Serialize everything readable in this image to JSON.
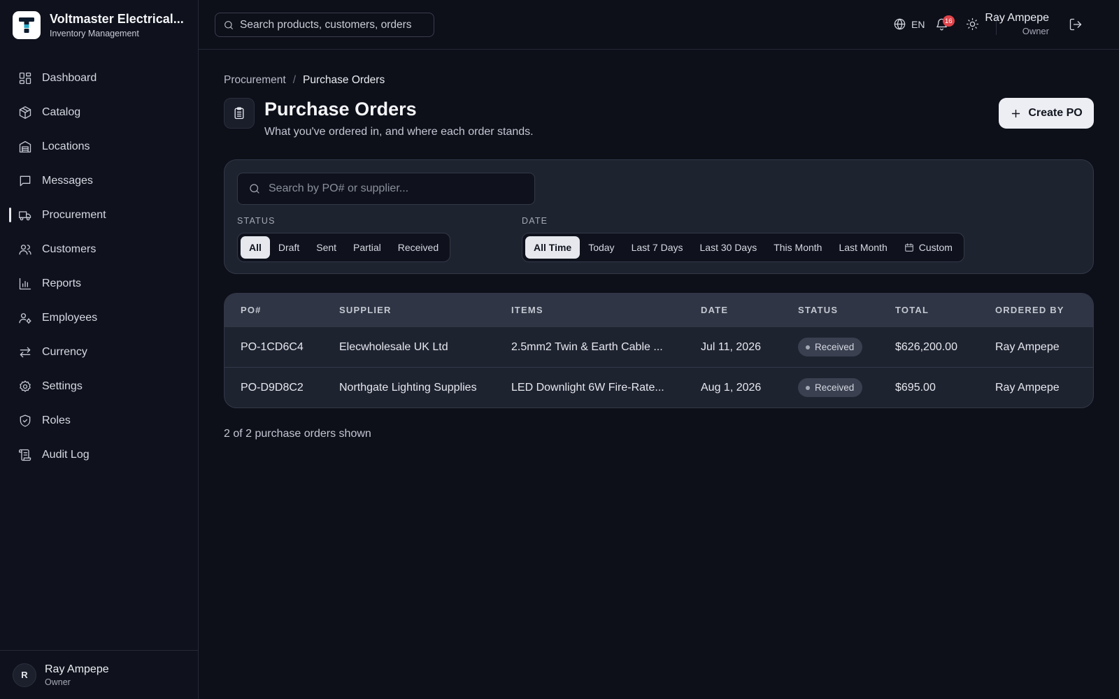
{
  "brand": {
    "name": "Voltmaster Electrical...",
    "subtitle": "Inventory Management"
  },
  "sidebar": {
    "items": [
      {
        "label": "Dashboard",
        "icon": "dashboard-icon"
      },
      {
        "label": "Catalog",
        "icon": "box-icon"
      },
      {
        "label": "Locations",
        "icon": "building-icon"
      },
      {
        "label": "Messages",
        "icon": "message-icon"
      },
      {
        "label": "Procurement",
        "icon": "truck-icon",
        "active": true
      },
      {
        "label": "Customers",
        "icon": "users-icon"
      },
      {
        "label": "Reports",
        "icon": "bar-chart-icon"
      },
      {
        "label": "Employees",
        "icon": "user-cog-icon"
      },
      {
        "label": "Currency",
        "icon": "arrows-icon"
      },
      {
        "label": "Settings",
        "icon": "gear-icon"
      },
      {
        "label": "Roles",
        "icon": "shield-icon"
      },
      {
        "label": "Audit Log",
        "icon": "scroll-icon"
      }
    ],
    "user": {
      "initial": "R",
      "name": "Ray Ampepe",
      "role": "Owner"
    }
  },
  "topbar": {
    "search_placeholder": "Search products, customers, orders",
    "language": "EN",
    "notification_count": "16",
    "user_name": "Ray Ampepe",
    "user_role": "Owner"
  },
  "breadcrumb": {
    "parent": "Procurement",
    "separator": "/",
    "current": "Purchase Orders"
  },
  "page": {
    "title": "Purchase Orders",
    "subtitle": "What you've ordered in, and where each order stands.",
    "create_label": "Create PO"
  },
  "filters": {
    "search_placeholder": "Search by PO# or supplier...",
    "status_label": "STATUS",
    "status_options": [
      "All",
      "Draft",
      "Sent",
      "Partial",
      "Received"
    ],
    "status_selected": "All",
    "date_label": "DATE",
    "date_options": [
      "All Time",
      "Today",
      "Last 7 Days",
      "Last 30 Days",
      "This Month",
      "Last Month",
      "Custom"
    ],
    "date_selected": "All Time"
  },
  "table": {
    "columns": [
      "PO#",
      "SUPPLIER",
      "ITEMS",
      "DATE",
      "STATUS",
      "TOTAL",
      "ORDERED BY"
    ],
    "rows": [
      {
        "po": "PO-1CD6C4",
        "supplier": "Elecwholesale UK Ltd",
        "items": "2.5mm2 Twin & Earth Cable ...",
        "date": "Jul 11, 2026",
        "status": "Received",
        "total": "$626,200.00",
        "ordered_by": "Ray Ampepe"
      },
      {
        "po": "PO-D9D8C2",
        "supplier": "Northgate Lighting Supplies",
        "items": "LED Downlight 6W Fire-Rate...",
        "date": "Aug 1, 2026",
        "status": "Received",
        "total": "$695.00",
        "ordered_by": "Ray Ampepe"
      }
    ]
  },
  "footer": {
    "count_text": "2 of 2 purchase orders shown"
  },
  "colors": {
    "background": "#0d0f19",
    "card": "#1e2330",
    "accent_light": "#eceef3",
    "badge_red": "#e0444a"
  }
}
